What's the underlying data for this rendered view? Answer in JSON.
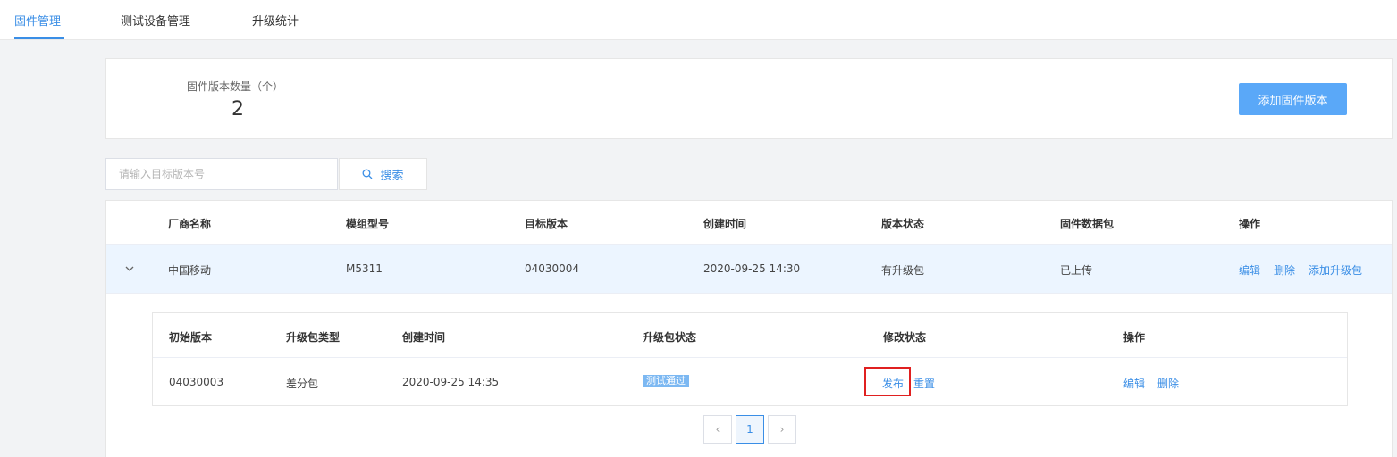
{
  "nav": {
    "tabs": [
      "固件管理",
      "测试设备管理",
      "升级统计"
    ],
    "active_index": 0
  },
  "summary": {
    "label": "固件版本数量（个）",
    "count": "2",
    "add_button": "添加固件版本"
  },
  "search": {
    "placeholder": "请输入目标版本号",
    "button": "搜索"
  },
  "table": {
    "columns": [
      "厂商名称",
      "模组型号",
      "目标版本",
      "创建时间",
      "版本状态",
      "固件数据包",
      "操作"
    ],
    "rows": [
      {
        "vendor": "中国移动",
        "module": "M5311",
        "target_version": "04030004",
        "created": "2020-09-25 14:30",
        "status": "有升级包",
        "package": "已上传",
        "actions": [
          "编辑",
          "删除",
          "添加升级包"
        ]
      }
    ]
  },
  "subtable": {
    "columns": [
      "初始版本",
      "升级包类型",
      "创建时间",
      "升级包状态",
      "修改状态",
      "操作"
    ],
    "rows": [
      {
        "initial_version": "04030003",
        "type": "差分包",
        "created": "2020-09-25 14:35",
        "status_badge": "测试通过",
        "modify_actions": [
          "发布",
          "重置"
        ],
        "actions": [
          "编辑",
          "删除"
        ]
      }
    ]
  },
  "pagination": {
    "prev": "‹",
    "current": "1",
    "next": "›"
  },
  "colors": {
    "accent": "#3a8ee6",
    "button": "#5aa8f8",
    "highlight": "#e02020"
  }
}
